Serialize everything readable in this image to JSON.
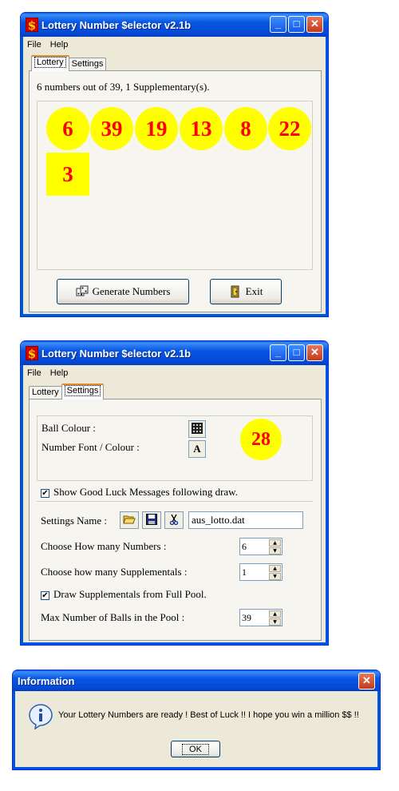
{
  "window1": {
    "title": "Lottery Number $elector v2.1b",
    "app_icon": "$",
    "menu": [
      "File",
      "Help"
    ],
    "tabs": [
      "Lottery",
      "Settings"
    ],
    "summary": "6 numbers out of 39, 1 Supplementary(s).",
    "balls": [
      "6",
      "39",
      "19",
      "13",
      "8",
      "22"
    ],
    "supplementary": [
      "3"
    ],
    "generate_button": "Generate Numbers",
    "exit_button": "Exit"
  },
  "window2": {
    "title": "Lottery Number $elector v2.1b",
    "app_icon": "$",
    "menu": [
      "File",
      "Help"
    ],
    "tabs": [
      "Lottery",
      "Settings"
    ],
    "ball_colour_label": "Ball Colour :",
    "font_colour_label": "Number Font / Colour :",
    "font_button_glyph": "A",
    "preview_ball": "28",
    "show_messages_label": "Show Good Luck Messages following draw.",
    "show_messages_checked": true,
    "settings_name_label": "Settings Name :",
    "settings_name_value": "aus_lotto.dat",
    "how_many_numbers_label": "Choose How many Numbers :",
    "how_many_numbers_value": "6",
    "how_many_supp_label": "Choose how many Supplementals :",
    "how_many_supp_value": "1",
    "draw_supp_label": "Draw Supplementals from Full Pool.",
    "draw_supp_checked": true,
    "max_balls_label": "Max Number of Balls in the Pool :",
    "max_balls_value": "39"
  },
  "dialog": {
    "title": "Information",
    "message": "Your Lottery Numbers are ready !  Best of Luck !!  I hope you win a million $$ !!",
    "ok_button": "OK"
  },
  "colors": {
    "ball_fill": "#ffff00",
    "ball_text": "#ff0000",
    "titlebar": "#0054e3",
    "window_face": "#ece9d8"
  },
  "titlebar_buttons": [
    "minimize",
    "maximize",
    "close"
  ]
}
